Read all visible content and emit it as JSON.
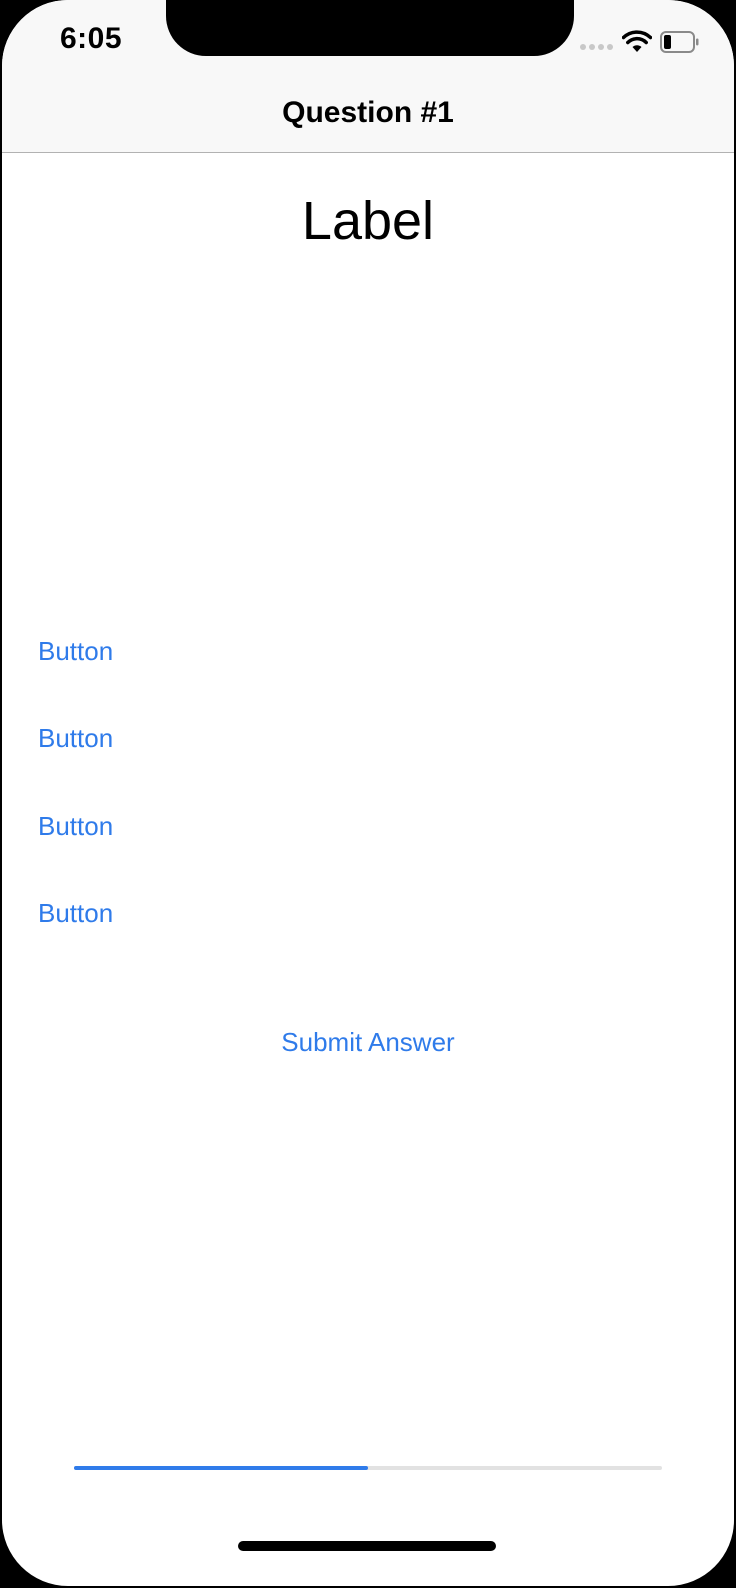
{
  "status_bar": {
    "time": "6:05"
  },
  "nav": {
    "title": "Question #1"
  },
  "question": {
    "label": "Label"
  },
  "answers": [
    {
      "label": "Button"
    },
    {
      "label": "Button"
    },
    {
      "label": "Button"
    },
    {
      "label": "Button"
    }
  ],
  "submit": {
    "label": "Submit Answer"
  },
  "progress": {
    "value": 0.5
  },
  "colors": {
    "accent": "#2f7bea",
    "track": "#e2e2e2"
  },
  "icons": [
    "signal-icon",
    "wifi-icon",
    "battery-icon"
  ]
}
